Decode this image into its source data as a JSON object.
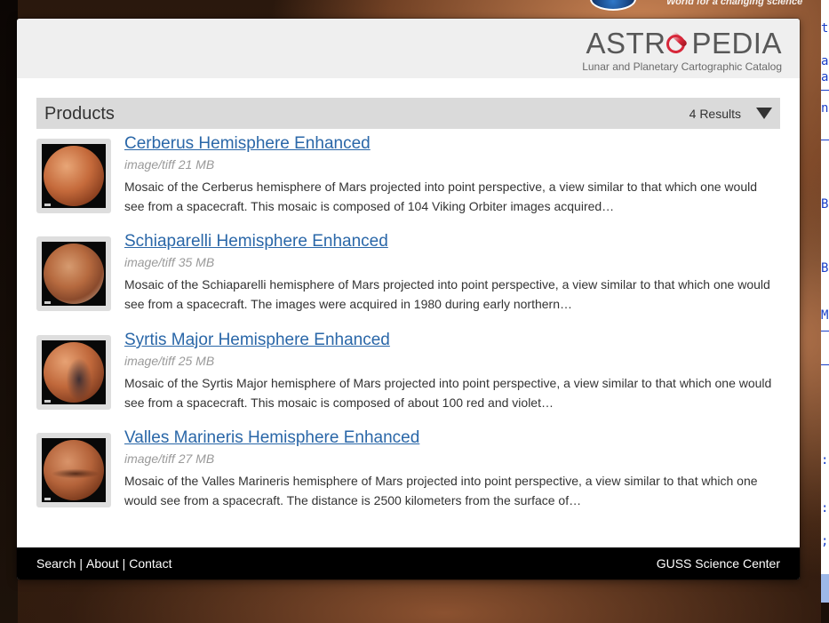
{
  "background": {
    "tagline": "World for a changing science"
  },
  "side_strip": {
    "chars": [
      "t",
      "a",
      "a",
      "n",
      "B",
      "B",
      "M",
      ":",
      ":",
      ";"
    ]
  },
  "brand": {
    "name_before": "ASTR",
    "name_after": "PEDIA",
    "subtitle": "Lunar and Planetary Cartographic Catalog",
    "accent_color": "#d7273a"
  },
  "products": {
    "title": "Products",
    "results_count": "4 Results",
    "toggle_icon": "caret-down-icon"
  },
  "results": [
    {
      "title": "Cerberus Hemisphere Enhanced",
      "meta": "image/tiff 21 MB",
      "description": "Mosaic of the Cerberus hemisphere of Mars projected into point perspective, a view similar to that which one would see from a spacecraft. This mosaic is composed of 104 Viking Orbiter images acquired…"
    },
    {
      "title": "Schiaparelli Hemisphere Enhanced",
      "meta": "image/tiff 35 MB",
      "description": "Mosaic of the Schiaparelli hemisphere of Mars projected into point perspective, a view similar to that which one would see from a spacecraft. The images were acquired in 1980 during early northern…"
    },
    {
      "title": "Syrtis Major Hemisphere Enhanced",
      "meta": "image/tiff 25 MB",
      "description": "Mosaic of the Syrtis Major hemisphere of Mars projected into point perspective, a view similar to that which one would see from a spacecraft. This mosaic is composed of about 100 red and violet…"
    },
    {
      "title": "Valles Marineris Hemisphere Enhanced",
      "meta": "image/tiff 27 MB",
      "description": "Mosaic of the Valles Marineris hemisphere of Mars projected into point perspective, a view similar to that which one would see from a spacecraft. The distance is 2500 kilometers from the surface of…"
    }
  ],
  "footer": {
    "links": [
      "Search",
      "About",
      "Contact"
    ],
    "separator": "|",
    "right_text": "GUSS Science Center"
  },
  "colors": {
    "link": "#2a67a8",
    "footer_bg": "#000000",
    "bar_bg": "#dadada"
  }
}
